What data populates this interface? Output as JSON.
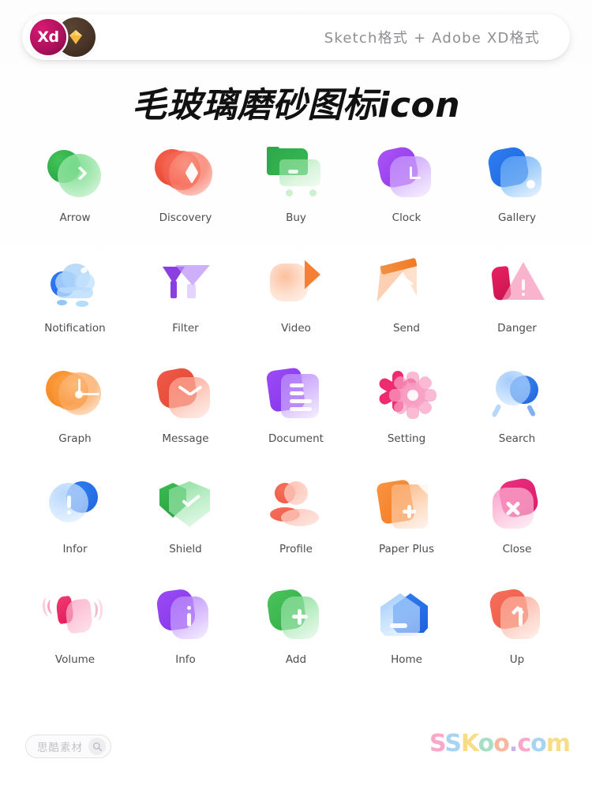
{
  "header": {
    "badge_xd_label": "Xd",
    "badge_xd_icon": "adobe-xd-logo",
    "badge_sketch_icon": "sketch-diamond-logo",
    "format_text": "Sketch格式 + Adobe XD格式"
  },
  "title": "毛玻璃磨砂图标icon",
  "icons": [
    {
      "label": "Arrow",
      "icon": "arrow-chevron-right-icon",
      "color": "#35b954"
    },
    {
      "label": "Discovery",
      "icon": "compass-icon",
      "color": "#f0503e"
    },
    {
      "label": "Buy",
      "icon": "shopping-cart-icon",
      "color": "#2fa84a"
    },
    {
      "label": "Clock",
      "icon": "clock-icon",
      "color": "#9333ea"
    },
    {
      "label": "Gallery",
      "icon": "photo-gallery-icon",
      "color": "#1c64de"
    },
    {
      "label": "Notification",
      "icon": "cloud-bell-icon",
      "color": "#2563eb"
    },
    {
      "label": "Filter",
      "icon": "funnel-filter-icon",
      "color": "#8b3fe0"
    },
    {
      "label": "Video",
      "icon": "video-camera-icon",
      "color": "#f58035"
    },
    {
      "label": "Send",
      "icon": "paper-plane-send-icon",
      "color": "#f07a26"
    },
    {
      "label": "Danger",
      "icon": "warning-triangle-icon",
      "color": "#e81f63"
    },
    {
      "label": "Graph",
      "icon": "pie-chart-icon",
      "color": "#f2841f"
    },
    {
      "label": "Message",
      "icon": "envelope-mail-icon",
      "color": "#e24632"
    },
    {
      "label": "Document",
      "icon": "document-lines-icon",
      "color": "#8433e8"
    },
    {
      "label": "Setting",
      "icon": "gear-settings-icon",
      "color": "#ef2a6e"
    },
    {
      "label": "Search",
      "icon": "magnifier-search-icon",
      "color": "#1f62db"
    },
    {
      "label": "Infor",
      "icon": "info-circle-icon",
      "color": "#1f62db"
    },
    {
      "label": "Shield",
      "icon": "shield-check-icon",
      "color": "#27a13e"
    },
    {
      "label": "Profile",
      "icon": "user-profile-icon",
      "color": "#ee5742"
    },
    {
      "label": "Paper Plus",
      "icon": "document-plus-icon",
      "color": "#f47b21"
    },
    {
      "label": "Close",
      "icon": "close-x-icon",
      "color": "#d81f6d"
    },
    {
      "label": "Volume",
      "icon": "speaker-volume-icon",
      "color": "#e01a5c"
    },
    {
      "label": "Info",
      "icon": "info-square-icon",
      "color": "#8433e8"
    },
    {
      "label": "Add",
      "icon": "plus-add-icon",
      "color": "#2faa43"
    },
    {
      "label": "Home",
      "icon": "home-house-icon",
      "color": "#1f62db"
    },
    {
      "label": "Up",
      "icon": "arrow-up-icon",
      "color": "#ef5742"
    }
  ],
  "footer": {
    "watermark_text": "思酷素材",
    "watermark_icon": "search-icon",
    "brand_letters": [
      "S",
      "S",
      "K",
      "o",
      "o",
      ".",
      "c",
      "o",
      "m"
    ],
    "brand_text": "SSKoo.com"
  },
  "colors": {
    "title": "#111111",
    "label": "#4d4d4d",
    "header_text": "#8e8e93",
    "xd_badge": "#b0115e",
    "sketch_badge": "#4a3527",
    "background": "#ffffff"
  }
}
